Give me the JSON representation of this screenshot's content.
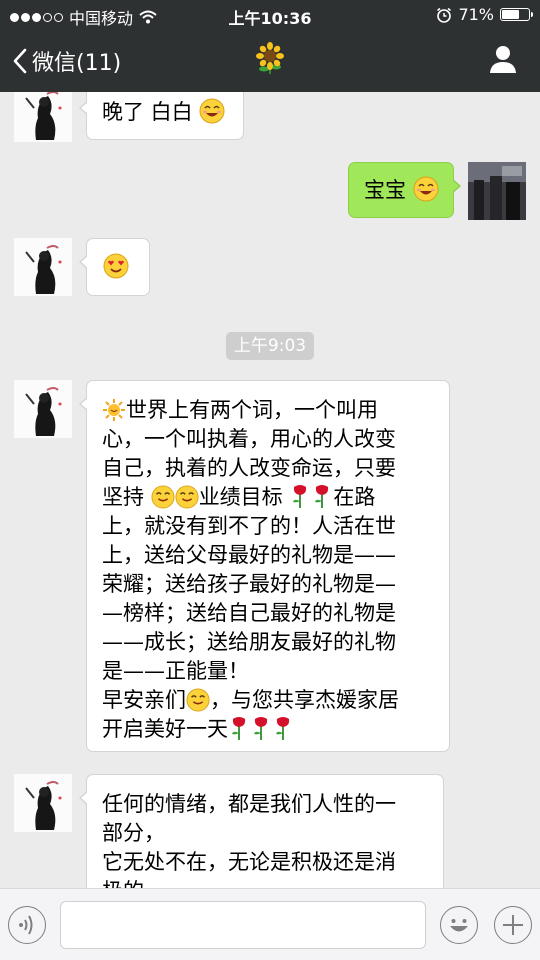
{
  "status_bar": {
    "carrier": "中国移动",
    "time": "上午10:36",
    "battery_text": "71%",
    "battery_level": 0.71
  },
  "nav": {
    "back_label": "微信(11)",
    "title_icon": "sunflower-icon",
    "profile_icon": "person-icon"
  },
  "messages": [
    {
      "from": "other",
      "text": "晚了 白白",
      "emoji": "smile-emoji"
    },
    {
      "from": "me",
      "text": "宝宝",
      "emoji": "smile-emoji"
    },
    {
      "from": "other",
      "text": "",
      "emoji": "heart-eyes-emoji"
    },
    {
      "from": "other",
      "lines": [
        "世界上有两个词，一个叫用",
        "心，一个叫执着，用心的人改变",
        "自己，执着的人改变命运，只要",
        "坚持",
        "业绩目标",
        "在路",
        "上，就没有到不了的！人活在世",
        "上，送给父母最好的礼物是——",
        "荣耀；送给孩子最好的礼物是—",
        "—榜样；送给自己最好的礼物是",
        "——成长；送给朋友最好的礼物",
        "是——正能量！",
        "早安亲们",
        "，与您共享杰媛家居",
        "开启美好一天"
      ]
    },
    {
      "from": "other",
      "lines": [
        "任何的情绪，都是我们人性的一",
        "部分，",
        "它无处不在，无论是积极还是消",
        "极的，"
      ]
    }
  ],
  "timestamp": "上午9:03",
  "input": {
    "voice_icon": "voice-icon",
    "emoji_icon": "emoji-face-icon",
    "plus_icon": "plus-icon",
    "value": ""
  },
  "colors": {
    "nav_bg": "#2e3132",
    "chat_bg": "#ebebeb",
    "my_bubble": "#a0e75a",
    "other_bubble": "#ffffff"
  }
}
